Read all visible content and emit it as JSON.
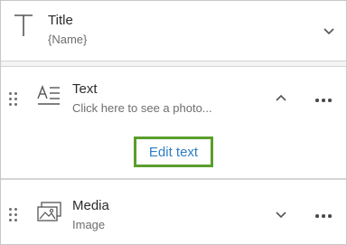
{
  "blocks": [
    {
      "title": "Title",
      "subtitle": "{Name}",
      "icon": "title-text-icon",
      "state": "collapsed"
    },
    {
      "title": "Text",
      "subtitle": "Click here to see a photo...",
      "icon": "text-block-icon",
      "state": "expanded",
      "action_label": "Edit text"
    },
    {
      "title": "Media",
      "subtitle": "Image",
      "icon": "image-icon",
      "state": "collapsed"
    }
  ],
  "colors": {
    "highlight_border": "#5a9e2b",
    "link_text": "#2f7ec2",
    "panel_background": "#f4f4f4"
  }
}
